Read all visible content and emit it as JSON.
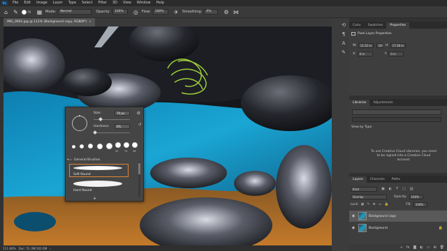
{
  "app": {
    "logo": "Ps"
  },
  "menu": [
    "File",
    "Edit",
    "Image",
    "Layer",
    "Type",
    "Select",
    "Filter",
    "3D",
    "View",
    "Window",
    "Help"
  ],
  "options": {
    "brush_size": "79",
    "mode_label": "Mode:",
    "mode_value": "Normal",
    "opacity_label": "Opacity:",
    "opacity_value": "100%",
    "flow_label": "Flow:",
    "flow_value": "100%",
    "smoothing_label": "Smoothing:",
    "smoothing_value": "0%"
  },
  "document": {
    "tab_title": "IMG_0002.jpg @ 112% (Background copy, RGB/8*)",
    "close": "×"
  },
  "status": {
    "zoom": "111.66%",
    "doc_size": "Doc: 51.3M/102.6M"
  },
  "brush_picker": {
    "size_label": "Size:",
    "size_value": "79 px",
    "hardness_label": "Hardness:",
    "hardness_value": "0%",
    "tips": [
      "",
      "",
      "",
      "",
      "",
      "",
      "32",
      "72",
      "36"
    ],
    "folder_label": "General Brushes",
    "brushes": [
      "Soft Round",
      "Hard Round"
    ]
  },
  "properties_panel": {
    "tabs": [
      "Color",
      "Swatches",
      "Properties"
    ],
    "active_tab": "Properties",
    "title": "Pixel Layer Properties",
    "w_label": "W:",
    "w_value": "11.52 in",
    "link_label": "GO",
    "h_label": "H:",
    "h_value": "17.28 in",
    "x_label": "X:",
    "x_value": "0 in",
    "y_label": "Y:",
    "y_value": "0 in"
  },
  "libraries_panel": {
    "tabs": [
      "Libraries",
      "Adjustments"
    ],
    "active_tab": "Libraries",
    "view_by": "View by Type",
    "message": "To use Creative Cloud Libraries, you need to be signed into a Creative Cloud account."
  },
  "layers_panel": {
    "tabs": [
      "Layers",
      "Channels",
      "Paths"
    ],
    "active_tab": "Layers",
    "kind_label": "Kind",
    "blend_mode": "Overlay",
    "opacity_label": "Opacity:",
    "opacity_value": "100%",
    "lock_label": "Lock:",
    "fill_label": "Fill:",
    "fill_value": "100%",
    "layers": [
      {
        "name": "Background copy",
        "selected": true
      },
      {
        "name": "Background",
        "selected": false
      }
    ]
  },
  "colors": {
    "accent": "#31a8ff",
    "selection_outline": "#e0863a",
    "water": "#1aa6d4"
  }
}
